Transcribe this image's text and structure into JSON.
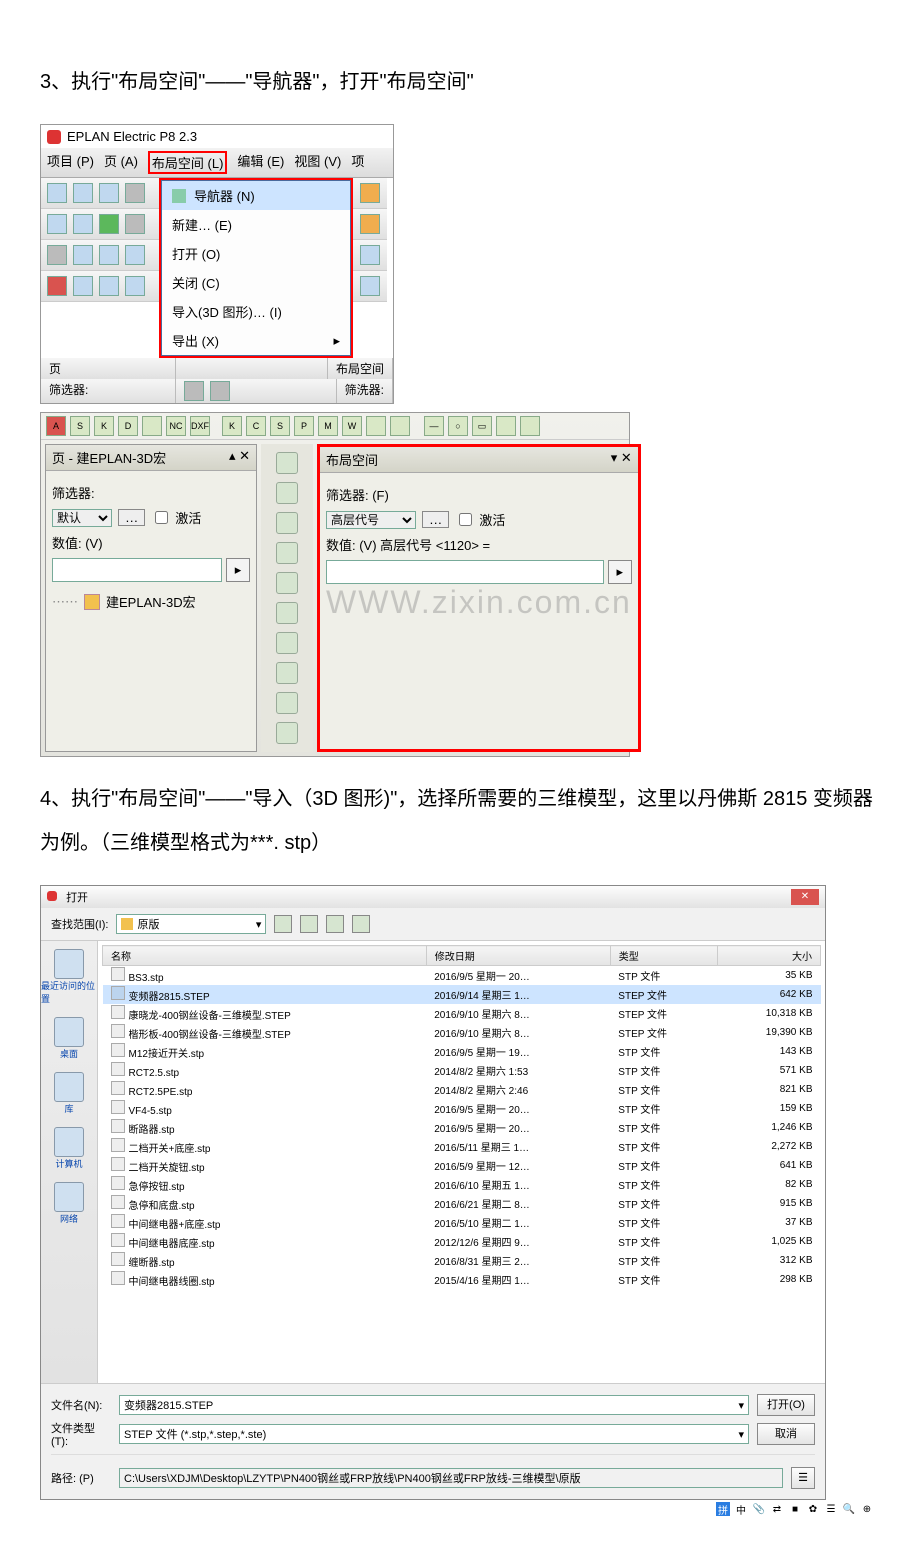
{
  "doc": {
    "p3": "3、执行\"布局空间\"——\"导航器\"，打开\"布局空间\"",
    "p4": "4、执行\"布局空间\"——\"导入（3D 图形)\"，选择所需要的三维模型，这里以丹佛斯 2815 变频器为例。（三维模型格式为***. stp）"
  },
  "eplan": {
    "title": "EPLAN Electric P8 2.3",
    "menu": {
      "project": "项目 (P)",
      "page": "页 (A)",
      "layout": "布局空间 (L)",
      "edit": "编辑 (E)",
      "view": "视图 (V)",
      "proj2": "项"
    },
    "dropdown": {
      "navigator": "导航器 (N)",
      "new": "新建… (E)",
      "open": "打开 (O)",
      "close": "关闭 (C)",
      "import3d": "导入(3D 图形)… (I)",
      "export": "导出 (X)"
    },
    "status": {
      "page": "页",
      "filter": "筛选器:",
      "layout_space": "布局空间",
      "filter2": "筛洗器:"
    }
  },
  "nav": {
    "left": {
      "title": "页 - 建EPLAN-3D宏",
      "filter_label": "筛选器:",
      "default": "默认",
      "activate": "激活",
      "value_label": "数值: (V)",
      "tree_item": "建EPLAN-3D宏"
    },
    "right": {
      "title": "布局空间",
      "filter_label": "筛选器: (F)",
      "combo": "高层代号",
      "activate": "激活",
      "value_label": "数值: (V) 高层代号 <1120> ="
    },
    "toolletters": [
      "S",
      "K",
      "D",
      "",
      "NC",
      "DXF",
      "K",
      "C",
      "S",
      "P",
      "M",
      "W"
    ]
  },
  "watermark": "WWW.zixin.com.cn",
  "dlg": {
    "title": "打开",
    "lookin_label": "查找范围(I):",
    "lookin_value": "原版",
    "sidebar": {
      "recent": "最近访问的位置",
      "desktop": "桌面",
      "libraries": "库",
      "computer": "计算机",
      "network": "网络"
    },
    "cols": {
      "name": "名称",
      "date": "修改日期",
      "type": "类型",
      "size": "大小"
    },
    "files": [
      {
        "name": "BS3.stp",
        "date": "2016/9/5 星期一 20…",
        "type": "STP 文件",
        "size": "35 KB"
      },
      {
        "name": "变频器2815.STEP",
        "date": "2016/9/14 星期三 1…",
        "type": "STEP 文件",
        "size": "642 KB",
        "sel": true
      },
      {
        "name": "康晓龙-400钢丝设备-三维模型.STEP",
        "date": "2016/9/10 星期六 8…",
        "type": "STEP 文件",
        "size": "10,318 KB"
      },
      {
        "name": "楷形板-400钢丝设备-三维模型.STEP",
        "date": "2016/9/10 星期六 8…",
        "type": "STEP 文件",
        "size": "19,390 KB"
      },
      {
        "name": "M12接近开关.stp",
        "date": "2016/9/5 星期一 19…",
        "type": "STP 文件",
        "size": "143 KB"
      },
      {
        "name": "RCT2.5.stp",
        "date": "2014/8/2 星期六 1:53",
        "type": "STP 文件",
        "size": "571 KB"
      },
      {
        "name": "RCT2.5PE.stp",
        "date": "2014/8/2 星期六 2:46",
        "type": "STP 文件",
        "size": "821 KB"
      },
      {
        "name": "VF4-5.stp",
        "date": "2016/9/5 星期一 20…",
        "type": "STP 文件",
        "size": "159 KB"
      },
      {
        "name": "断路器.stp",
        "date": "2016/9/5 星期一 20…",
        "type": "STP 文件",
        "size": "1,246 KB"
      },
      {
        "name": "二档开关+底座.stp",
        "date": "2016/5/11 星期三 1…",
        "type": "STP 文件",
        "size": "2,272 KB"
      },
      {
        "name": "二档开关旋钮.stp",
        "date": "2016/5/9 星期一 12…",
        "type": "STP 文件",
        "size": "641 KB"
      },
      {
        "name": "急停按钮.stp",
        "date": "2016/6/10 星期五 1…",
        "type": "STP 文件",
        "size": "82 KB"
      },
      {
        "name": "急停和底盘.stp",
        "date": "2016/6/21 星期二 8…",
        "type": "STP 文件",
        "size": "915 KB"
      },
      {
        "name": "中间继电器+底座.stp",
        "date": "2016/5/10 星期二 1…",
        "type": "STP 文件",
        "size": "37 KB"
      },
      {
        "name": "中间继电器底座.stp",
        "date": "2012/12/6 星期四 9…",
        "type": "STP 文件",
        "size": "1,025 KB"
      },
      {
        "name": "缠断器.stp",
        "date": "2016/8/31 星期三 2…",
        "type": "STP 文件",
        "size": "312 KB"
      },
      {
        "name": "中间继电器线圈.stp",
        "date": "2015/4/16 星期四 1…",
        "type": "STP 文件",
        "size": "298 KB"
      }
    ],
    "filename_label": "文件名(N):",
    "filename_value": "变频器2815.STEP",
    "filetype_label": "文件类型(T):",
    "filetype_value": "STEP 文件 (*.stp,*.step,*.ste)",
    "path_label": "路径: (P)",
    "path_value": "C:\\Users\\XDJM\\Desktop\\LZYTP\\PN400钢丝或FRP放线\\PN400钢丝或FRP放线-三维模型\\原版",
    "open_btn": "打开(O)",
    "cancel_btn": "取消"
  },
  "tray": [
    "拼",
    "中",
    "📎",
    "⇄",
    "■",
    "✿",
    "☰",
    "🔍",
    "⊕"
  ]
}
